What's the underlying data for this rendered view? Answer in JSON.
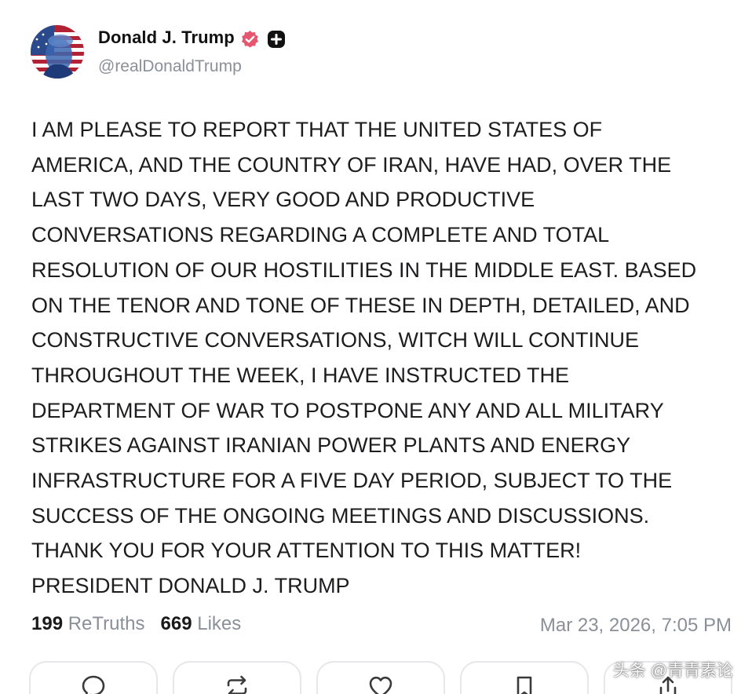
{
  "author": {
    "display_name": "Donald J. Trump",
    "handle": "@realDonaldTrump",
    "verified_badge_color": "#e5566f",
    "avatar_icon": "flag-portrait-avatar"
  },
  "post": {
    "lines": [
      "I AM PLEASE TO REPORT THAT THE UNITED STATES OF",
      "AMERICA, AND THE COUNTRY OF IRAN, HAVE HAD, OVER THE",
      "LAST TWO DAYS, VERY GOOD AND PRODUCTIVE",
      "CONVERSATIONS REGARDING A COMPLETE AND TOTAL",
      "RESOLUTION OF OUR HOSTILITIES IN THE MIDDLE EAST. BASED",
      "ON THE TENOR AND TONE OF THESE IN DEPTH, DETAILED, AND",
      "CONSTRUCTIVE CONVERSATIONS, WITCH WILL CONTINUE",
      "THROUGHOUT THE WEEK, I HAVE INSTRUCTED THE",
      "DEPARTMENT OF WAR TO POSTPONE ANY AND ALL MILITARY",
      "STRIKES AGAINST IRANIAN POWER PLANTS AND ENERGY",
      "INFRASTRUCTURE FOR A FIVE DAY PERIOD, SUBJECT TO THE",
      "SUCCESS OF THE ONGOING MEETINGS AND DISCUSSIONS.",
      "THANK YOU FOR YOUR ATTENTION TO THIS MATTER!",
      "PRESIDENT DONALD J. TRUMP"
    ]
  },
  "stats": {
    "retruths_count": "199",
    "retruths_label": "ReTruths",
    "likes_count": "669",
    "likes_label": "Likes",
    "timestamp": "Mar 23, 2026, 7:05 PM"
  },
  "actions": [
    {
      "icon": "reply-icon"
    },
    {
      "icon": "retruth-icon"
    },
    {
      "icon": "like-icon"
    },
    {
      "icon": "bookmark-icon"
    },
    {
      "icon": "share-icon"
    }
  ],
  "watermark": {
    "text": "头条 @青青素论"
  },
  "colors": {
    "text": "#1d1d1f",
    "muted": "#8a8f98",
    "border": "#e6e7ea"
  }
}
